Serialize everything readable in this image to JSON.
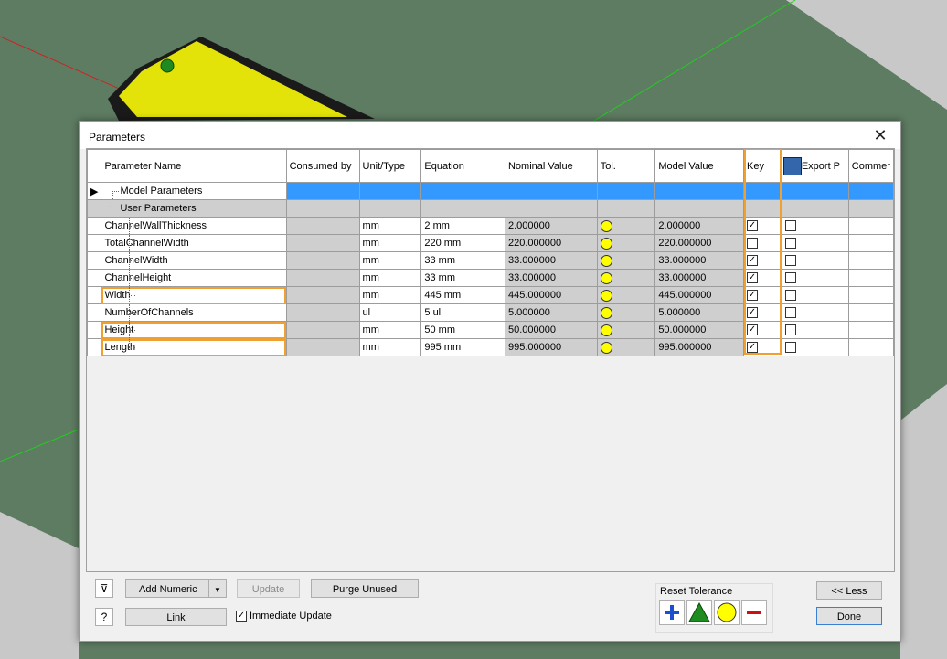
{
  "dialog": {
    "title": "Parameters"
  },
  "grid": {
    "columns": [
      "Parameter Name",
      "Consumed by",
      "Unit/Type",
      "Equation",
      "Nominal Value",
      "Tol.",
      "Model Value",
      "Key",
      "Export P",
      "Commer"
    ],
    "groups": {
      "model": "Model Parameters",
      "user": "User Parameters"
    },
    "rows": [
      {
        "name": "ChannelWallThickness",
        "unit": "mm",
        "equation": "2 mm",
        "nominal": "2.000000",
        "model": "2.000000",
        "key": true,
        "export": false
      },
      {
        "name": "TotalChannelWidth",
        "unit": "mm",
        "equation": "220 mm",
        "nominal": "220.000000",
        "model": "220.000000",
        "key": false,
        "export": false
      },
      {
        "name": "ChannelWidth",
        "unit": "mm",
        "equation": "33 mm",
        "nominal": "33.000000",
        "model": "33.000000",
        "key": true,
        "export": false
      },
      {
        "name": "ChannelHeight",
        "unit": "mm",
        "equation": "33 mm",
        "nominal": "33.000000",
        "model": "33.000000",
        "key": true,
        "export": false
      },
      {
        "name": "Width",
        "unit": "mm",
        "equation": "445 mm",
        "nominal": "445.000000",
        "model": "445.000000",
        "key": true,
        "export": false,
        "highlight": true
      },
      {
        "name": "NumberOfChannels",
        "unit": "ul",
        "equation": "5 ul",
        "nominal": "5.000000",
        "model": "5.000000",
        "key": true,
        "export": false
      },
      {
        "name": "Height",
        "unit": "mm",
        "equation": "50 mm",
        "nominal": "50.000000",
        "model": "50.000000",
        "key": true,
        "export": false,
        "highlight": true
      },
      {
        "name": "Length",
        "unit": "mm",
        "equation": "995 mm",
        "nominal": "995.000000",
        "model": "995.000000",
        "key": true,
        "export": false,
        "highlight": true
      }
    ]
  },
  "buttons": {
    "add_numeric": "Add Numeric",
    "update": "Update",
    "purge_unused": "Purge Unused",
    "link": "Link",
    "less": "<< Less",
    "done": "Done"
  },
  "immediate_update": {
    "label": "Immediate Update",
    "checked": true
  },
  "reset_tolerance": {
    "label": "Reset Tolerance"
  },
  "colors": {
    "selection": "#3399ff",
    "highlight": "#f0a030",
    "tolerance_dot": "#ffff00",
    "viewport_green": "#5e7c62",
    "part_yellow": "#e3e30a"
  }
}
